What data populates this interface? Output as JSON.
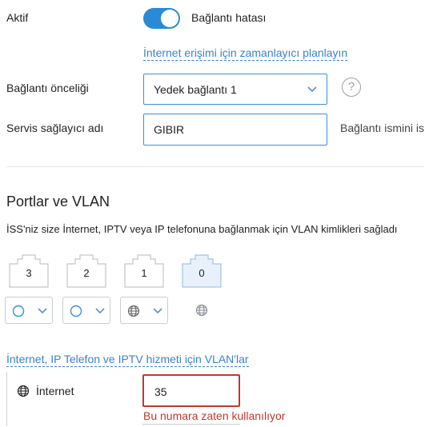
{
  "status": {
    "label": "Aktif",
    "toggle_on": true,
    "toggle_color": "#2a8ad6",
    "connection_status": "Bağlantı hatası"
  },
  "schedule_link": "İnternet erişimi için zamanlayıcı planlayın",
  "priority": {
    "label": "Bağlantı önceliği",
    "value": "Yedek bağlantı 1",
    "help": "?"
  },
  "isp": {
    "label": "Servis sağlayıcı adı",
    "value": "GIBIR",
    "hint": "Bağlantı ismini is"
  },
  "ports_section": {
    "title": "Portlar ve VLAN",
    "description": "İSS'niz size İnternet, IPTV veya IP telefonuna bağlanmak için VLAN kimlikleri sağladı",
    "ports": [
      {
        "number": "3",
        "active": false,
        "mode_icon": "circle-icon"
      },
      {
        "number": "2",
        "active": false,
        "mode_icon": "circle-icon"
      },
      {
        "number": "1",
        "active": false,
        "mode_icon": "globe-icon"
      },
      {
        "number": "0",
        "active": true,
        "mode_icon": "globe-icon"
      }
    ],
    "vlan_link": "İnternet, IP Telefon ve IPTV hizmeti için VLAN'lar"
  },
  "vlan_internet": {
    "label": "İnternet",
    "value": "35",
    "error": "Bu numara zaten kullanılıyor",
    "error_color": "#c0392b"
  }
}
